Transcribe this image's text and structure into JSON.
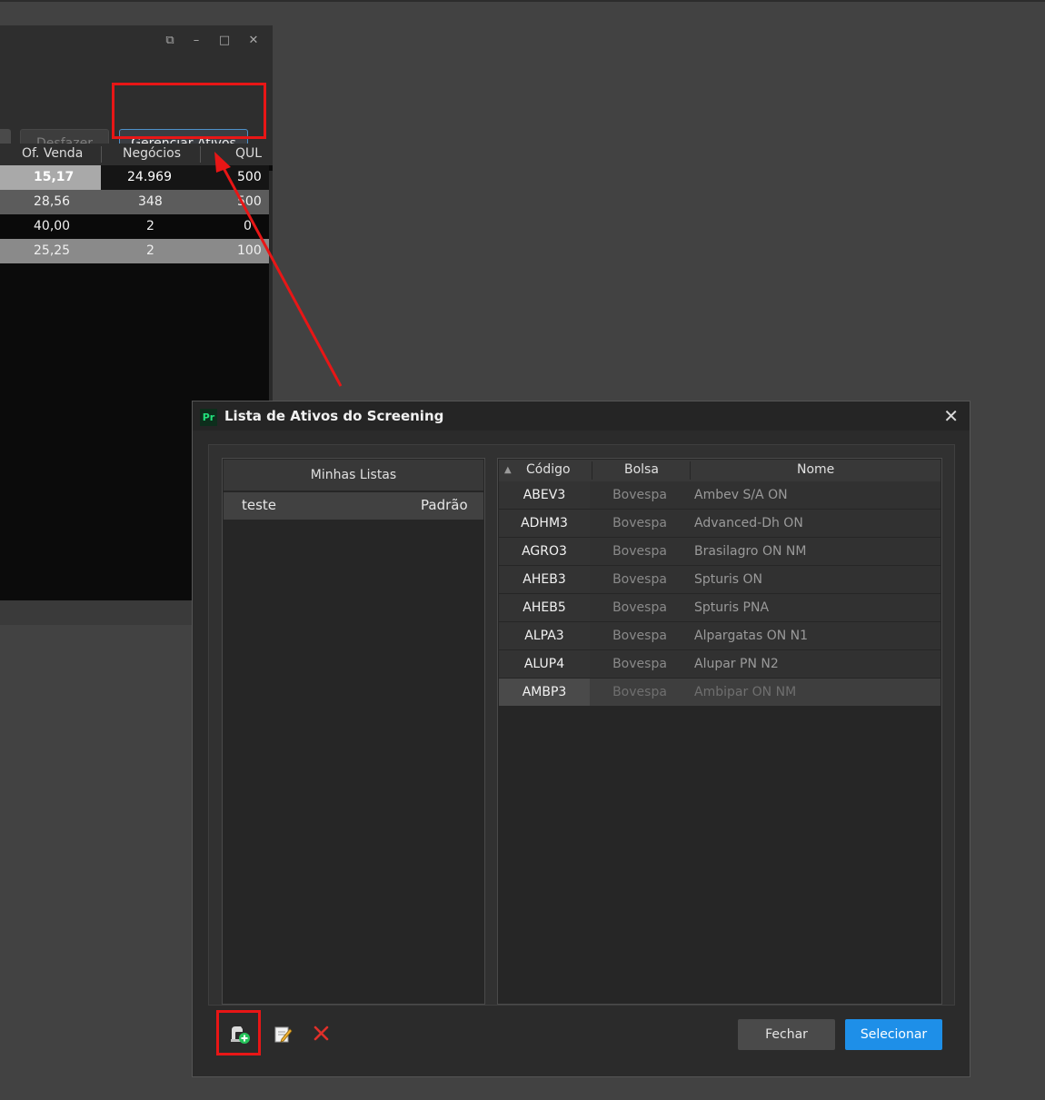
{
  "background_window": {
    "window_controls": [
      "⧉",
      "–",
      "□",
      "✕"
    ],
    "toolbar": {
      "undo_label": "Desfazer",
      "manage_label": "Gerenciar Ativos"
    },
    "grid": {
      "headers": [
        "Of. Venda",
        "Negócios",
        "QUL"
      ],
      "rows": [
        {
          "of_venda": "15,17",
          "negocios": "24.969",
          "qul": "500"
        },
        {
          "of_venda": "28,56",
          "negocios": "348",
          "qul": "500"
        },
        {
          "of_venda": "40,00",
          "negocios": "2",
          "qul": "0"
        },
        {
          "of_venda": "25,25",
          "negocios": "2",
          "qul": "100"
        }
      ]
    }
  },
  "dialog": {
    "logo": "Pr",
    "title": "Lista de Ativos do Screening",
    "close": "✕",
    "lists": {
      "header": "Minhas Listas",
      "items": [
        {
          "name": "teste",
          "type": "Padrão"
        }
      ]
    },
    "assets": {
      "sort_indicator": "▲",
      "headers": {
        "code": "Código",
        "exchange": "Bolsa",
        "name": "Nome"
      },
      "rows": [
        {
          "code": "ABEV3",
          "exchange": "Bovespa",
          "name": "Ambev S/A ON"
        },
        {
          "code": "ADHM3",
          "exchange": "Bovespa",
          "name": "Advanced-Dh ON"
        },
        {
          "code": "AGRO3",
          "exchange": "Bovespa",
          "name": "Brasilagro ON NM"
        },
        {
          "code": "AHEB3",
          "exchange": "Bovespa",
          "name": "Spturis ON"
        },
        {
          "code": "AHEB5",
          "exchange": "Bovespa",
          "name": "Spturis PNA"
        },
        {
          "code": "ALPA3",
          "exchange": "Bovespa",
          "name": "Alpargatas ON N1"
        },
        {
          "code": "ALUP4",
          "exchange": "Bovespa",
          "name": "Alupar PN N2"
        },
        {
          "code": "AMBP3",
          "exchange": "Bovespa",
          "name": "Ambipar ON NM"
        }
      ]
    },
    "footer": {
      "close_label": "Fechar",
      "select_label": "Selecionar"
    }
  },
  "colors": {
    "highlight": "#e81616",
    "accent": "#1e8fe8"
  }
}
